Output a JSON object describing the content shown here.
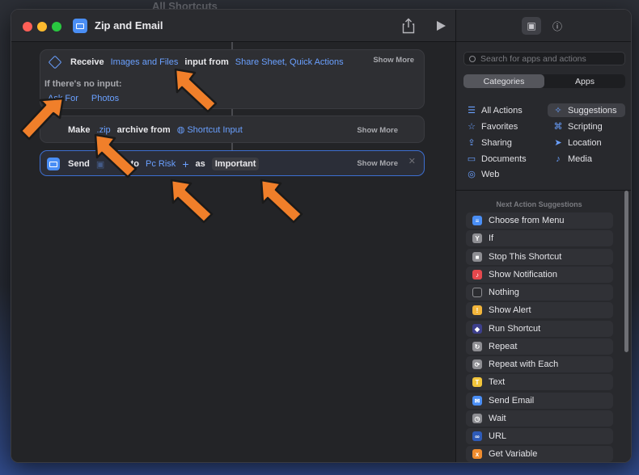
{
  "background": {
    "window_title": "All Shortcuts"
  },
  "window": {
    "title": "Zip and Email"
  },
  "actions": [
    {
      "keyword": "Receive",
      "tokens": [
        "Images and Files",
        "input from",
        "Share Sheet, Quick Actions"
      ],
      "show_more": "Show More",
      "no_input_label": "If there's no input:",
      "no_input_options": [
        "Ask For",
        "Photos"
      ]
    },
    {
      "keyword": "Make",
      "tokens": [
        ".zip",
        "archive from",
        "Shortcut Input"
      ],
      "show_more": "Show More"
    },
    {
      "keyword": "Send",
      "tokens": [
        "to",
        "Pc Risk",
        "+",
        "as",
        "Important"
      ],
      "show_more": "Show More"
    }
  ],
  "sidebar": {
    "search_placeholder": "Search for apps and actions",
    "segments": [
      "Categories",
      "Apps"
    ],
    "categories": [
      {
        "label": "All Actions",
        "icon": "list-icon"
      },
      {
        "label": "Suggestions",
        "icon": "sparkle-icon"
      },
      {
        "label": "Favorites",
        "icon": "star-icon"
      },
      {
        "label": "Scripting",
        "icon": "script-icon"
      },
      {
        "label": "Sharing",
        "icon": "share-icon"
      },
      {
        "label": "Location",
        "icon": "location-arrow-icon"
      },
      {
        "label": "Documents",
        "icon": "document-icon"
      },
      {
        "label": "Media",
        "icon": "music-note-icon"
      },
      {
        "label": "Web",
        "icon": "compass-icon"
      }
    ],
    "suggestions_header": "Next Action Suggestions",
    "suggestions": [
      {
        "label": "Choose from Menu",
        "color": "#4a8ef5",
        "icon": "menu-icon"
      },
      {
        "label": "If",
        "color": "#8e8e93",
        "icon": "branch-icon"
      },
      {
        "label": "Stop This Shortcut",
        "color": "#8e8e93",
        "icon": "stop-icon"
      },
      {
        "label": "Show Notification",
        "color": "#e5484d",
        "icon": "bell-icon"
      },
      {
        "label": "Nothing",
        "color": "#2b2c30",
        "icon": "empty-square-icon"
      },
      {
        "label": "Show Alert",
        "color": "#f2b53b",
        "icon": "alert-icon"
      },
      {
        "label": "Run Shortcut",
        "color": "#3d3f8c",
        "icon": "shortcuts-icon"
      },
      {
        "label": "Repeat",
        "color": "#8e8e93",
        "icon": "repeat-icon"
      },
      {
        "label": "Repeat with Each",
        "color": "#8e8e93",
        "icon": "repeat-each-icon"
      },
      {
        "label": "Text",
        "color": "#f2c53b",
        "icon": "text-icon"
      },
      {
        "label": "Send Email",
        "color": "#4a8ef5",
        "icon": "mail-icon"
      },
      {
        "label": "Wait",
        "color": "#8e8e93",
        "icon": "clock-icon"
      },
      {
        "label": "URL",
        "color": "#2e5bb8",
        "icon": "link-icon"
      },
      {
        "label": "Get Variable",
        "color": "#f08c2e",
        "icon": "variable-icon"
      }
    ]
  },
  "colors": {
    "accent": "#6aa0ff",
    "arrow": "#f07f2a",
    "selection_border": "#3d6fd1"
  }
}
